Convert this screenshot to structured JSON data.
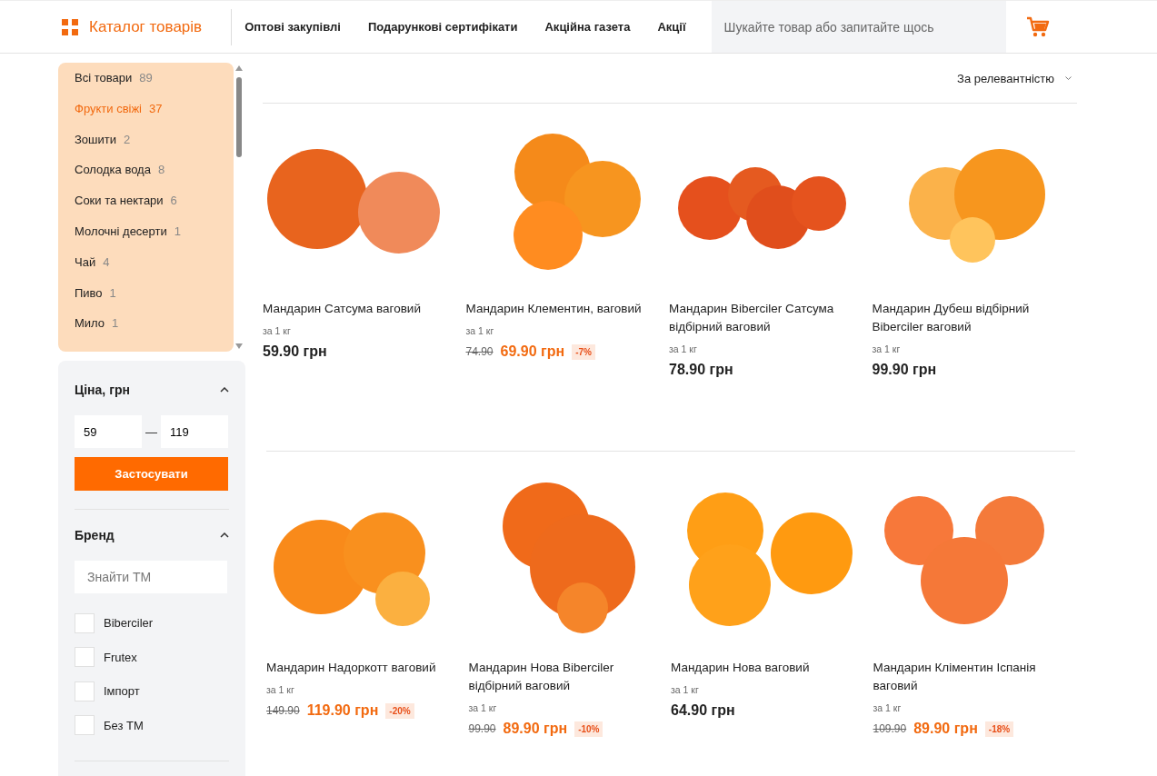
{
  "header": {
    "catalog_label": "Каталог товарів",
    "nav": [
      "Оптові закупівлі",
      "Подарункові сертифікати",
      "Акційна газета",
      "Акції"
    ],
    "search": {
      "placeholder": "Шукайте товар або запитайте щось"
    }
  },
  "categories": [
    {
      "name": "Всі товари",
      "count": "89",
      "selected": false
    },
    {
      "name": "Фрукти свіжі",
      "count": "37",
      "selected": true
    },
    {
      "name": "Зошити",
      "count": "2",
      "selected": false
    },
    {
      "name": "Солодка вода",
      "count": "8",
      "selected": false
    },
    {
      "name": "Соки та нектари",
      "count": "6",
      "selected": false
    },
    {
      "name": "Молочні десерти",
      "count": "1",
      "selected": false
    },
    {
      "name": "Чай",
      "count": "4",
      "selected": false
    },
    {
      "name": "Пиво",
      "count": "1",
      "selected": false
    },
    {
      "name": "Мило",
      "count": "1",
      "selected": false
    }
  ],
  "price_filter": {
    "title": "Ціна, грн",
    "expanded": true,
    "min": "59",
    "separator": "—",
    "max": "119",
    "apply_button": "Застосувати"
  },
  "brand_filter": {
    "title": "Бренд",
    "expanded": true,
    "search": {
      "placeholder": "Знайти ТМ"
    },
    "brands": [
      {
        "name": "Biberciler",
        "checked": false
      },
      {
        "name": "Frutex",
        "checked": false
      },
      {
        "name": "Імпорт",
        "checked": false
      },
      {
        "name": "Без ТМ",
        "checked": false
      }
    ]
  },
  "sort": {
    "label": "За релевантністю"
  },
  "products": [
    {
      "name": "Мандарин Сатсума ваговий",
      "unit": "за 1 кг",
      "price": "59.90 грн"
    },
    {
      "name": "Мандарин Клементин, ваговий",
      "unit": "за 1 кг",
      "old_price": "74.90",
      "price": "69.90 грн",
      "discount": "-7%"
    },
    {
      "name": "Мандарин Biberciler Сатсума відбірний ваговий",
      "unit": "за 1 кг",
      "price": "78.90 грн"
    },
    {
      "name": "Мандарин Дубеш відбірний Biberciler ваговий",
      "unit": "за 1 кг",
      "price": "99.90 грн"
    },
    {
      "name": "Мандарин Надоркотт ваговий",
      "unit": "за 1 кг",
      "old_price": "149.90",
      "price": "119.90 грн",
      "discount": "-20%"
    },
    {
      "name": "Мандарин Нова Biberciler відбірний ваговий",
      "unit": "за 1 кг",
      "old_price": "99.90",
      "price": "89.90 грн",
      "discount": "-10%"
    },
    {
      "name": "Мандарин Нова ваговий",
      "unit": "за 1 кг",
      "price": "64.90 грн"
    },
    {
      "name": "Мандарин Кліментин Іспанія ваговий",
      "unit": "за 1 кг",
      "old_price": "109.90",
      "price": "89.90 грн",
      "discount": "-18%"
    }
  ]
}
